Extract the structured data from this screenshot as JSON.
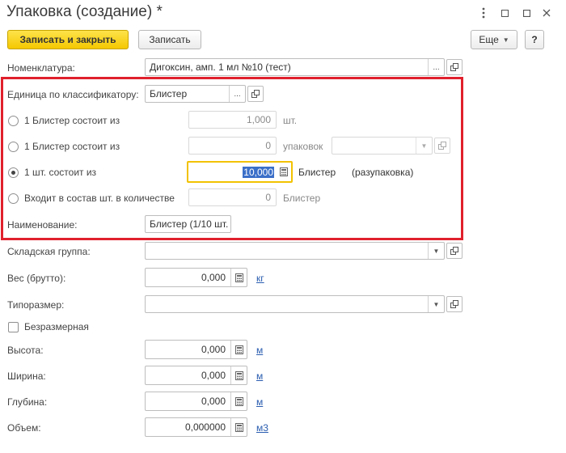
{
  "window": {
    "title": "Упаковка (создание) *",
    "menu_icon": "kebab-icon",
    "restore_icon": "restore-icon",
    "close_icon": "close-icon"
  },
  "toolbar": {
    "write_close_label": "Записать и закрыть",
    "write_label": "Записать",
    "more_label": "Еще",
    "help_label": "?"
  },
  "form": {
    "nomenclature": {
      "label": "Номенклатура:",
      "value": "Дигоксин, амп. 1 мл №10 (тест)"
    },
    "unit_classifier": {
      "label": "Единица по классификатору:",
      "value": "Блистер"
    },
    "option1": {
      "label": "1 Блистер состоит из",
      "value": "1,000",
      "unit": "шт."
    },
    "option2": {
      "label": "1 Блистер состоит из",
      "value": "0",
      "unit": "упаковок",
      "select_value": ""
    },
    "option3": {
      "label": "1 шт. состоит из",
      "value": "10,000",
      "unit": "Блистер",
      "note": "(разупаковка)"
    },
    "option4": {
      "label": "Входит в состав шт. в количестве",
      "value": "0",
      "unit": "Блистер"
    },
    "name": {
      "label": "Наименование:",
      "value": "Блистер (1/10 шт."
    },
    "warehouse_group": {
      "label": "Складская группа:",
      "value": ""
    },
    "weight": {
      "label": "Вес (брутто):",
      "value": "0,000",
      "unit": "кг"
    },
    "size_type": {
      "label": "Типоразмер:",
      "value": ""
    },
    "sizeless": {
      "label": "Безразмерная",
      "checked": false
    },
    "height": {
      "label": "Высота:",
      "value": "0,000",
      "unit": "м"
    },
    "width": {
      "label": "Ширина:",
      "value": "0,000",
      "unit": "м"
    },
    "depth": {
      "label": "Глубина:",
      "value": "0,000",
      "unit": "м"
    },
    "volume": {
      "label": "Объем:",
      "value": "0,000000",
      "unit": "м3"
    }
  },
  "colors": {
    "highlight": "#e0202c",
    "primary_button": "#f5c800",
    "link": "#2a5db0",
    "focus": "#f2c200"
  }
}
